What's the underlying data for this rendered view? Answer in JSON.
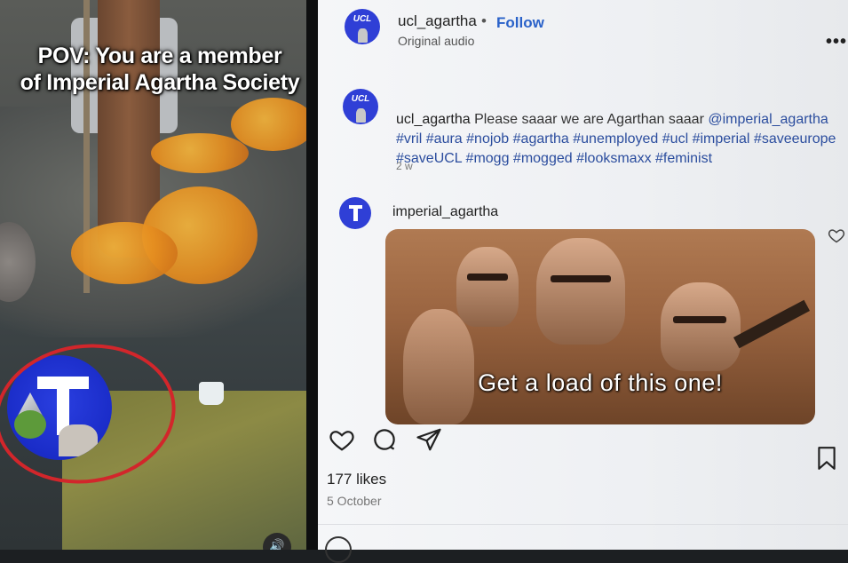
{
  "video": {
    "overlay_line1": "POV: You are a member",
    "overlay_line2": "of Imperial Agartha Society"
  },
  "post": {
    "username": "ucl_agartha",
    "separator": "•",
    "follow_label": "Follow",
    "audio_label": "Original audio",
    "more_icon": "•••"
  },
  "caption": {
    "username": "ucl_agartha",
    "text": "Please saaar we are Agarthan saaar",
    "mention": "@imperial_agartha",
    "hashtags": "#vril #aura #nojob #agartha #unemployed #ucl #imperial #saveeurope #saveUCL #mogg #mogged #looksmaxx #feminist",
    "time": "2 w"
  },
  "comment": {
    "username": "imperial_agartha",
    "gif_subtitle": "Get a load of this one!"
  },
  "footer": {
    "likes": "177 likes",
    "date": "5 October"
  },
  "colors": {
    "follow": "#2a62c9",
    "hashtag": "#2b4d9e",
    "annotation_ring": "#d2262b",
    "avatar_blue": "#2f3fd6"
  }
}
